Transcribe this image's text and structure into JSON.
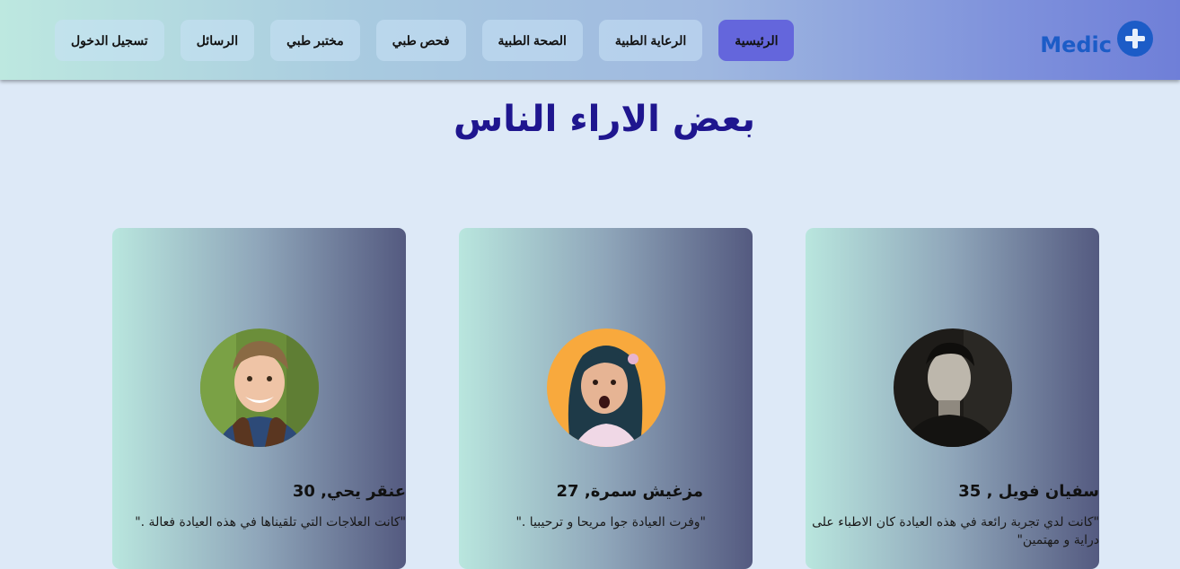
{
  "brand": {
    "name": "Medic",
    "icon": "plus-circle-icon",
    "color": "#1c5cc7"
  },
  "nav": {
    "items": [
      {
        "label": "تسجيل الدخول"
      },
      {
        "label": "الرسائل"
      },
      {
        "label": "مختبر طبي"
      },
      {
        "label": "فحص طبي"
      },
      {
        "label": "الصحة الطبية"
      },
      {
        "label": "الرعاية الطبية"
      },
      {
        "label": "الرئيسية",
        "active": true
      }
    ],
    "active_color": "#6466dc"
  },
  "testimonials": {
    "title": "بعض الاراء الناس",
    "title_color": "#1f168f",
    "cards": [
      {
        "name": "سفيان فويل , 35",
        "quote": "\"كانت لدي تجربة رائعة في هذه العيادة كان الاطباء على دراية و مهتمين\"",
        "avatar": "man-portrait-photo"
      },
      {
        "name": "مزغيش سمرة, 27",
        "quote": "\"وفرت العيادة جوا مريحا و ترحيبيا .\"",
        "avatar": "girl-portrait-photo"
      },
      {
        "name": "عنقر يحي, 30",
        "quote": "\"كانت العلاجات التي تلقيناها في هذه العيادة فعالة .\"",
        "avatar": "boy-portrait-photo"
      }
    ]
  }
}
